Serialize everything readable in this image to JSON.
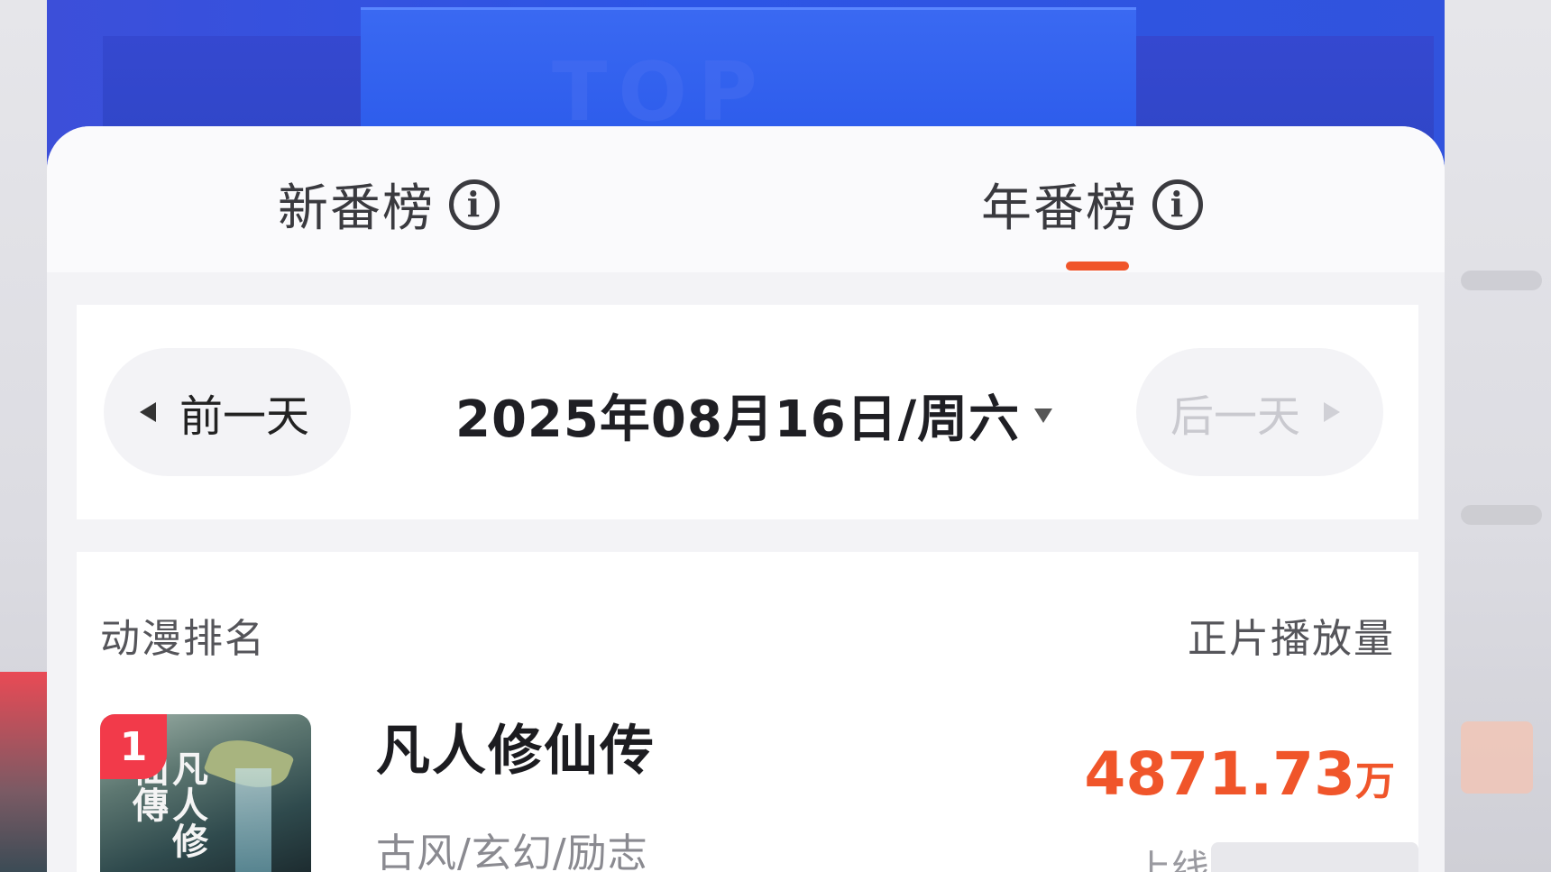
{
  "hero": {
    "top_text": "TOP"
  },
  "tabs": [
    {
      "label": "新番榜",
      "info_icon": "info-icon"
    },
    {
      "label": "年番榜",
      "info_icon": "info-icon",
      "active": true
    }
  ],
  "date_nav": {
    "prev_label": "前一天",
    "date": "2025年08月16日/周六",
    "next_label": "后一天"
  },
  "list": {
    "header_left": "动漫排名",
    "header_right": "正片播放量",
    "items": [
      {
        "rank": "1",
        "title": "凡人修仙传",
        "tags": "古风/玄幻/励志",
        "views_number": "4871.73",
        "views_unit": "万",
        "poster_text": "凡人修仙傳",
        "cut_text": "上线"
      }
    ]
  },
  "colors": {
    "accent": "#f0552a",
    "rank_badge": "#f23a4a",
    "hero_blue": "#2c55e6"
  }
}
